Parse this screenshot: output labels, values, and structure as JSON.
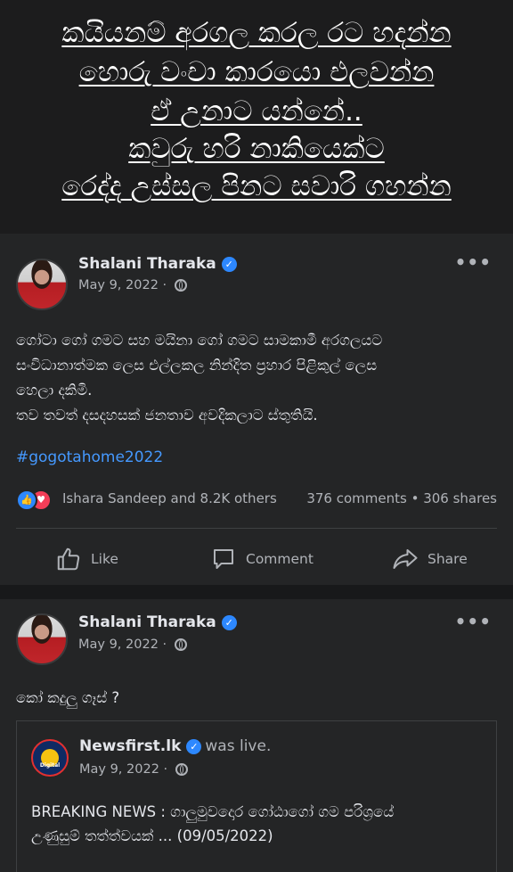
{
  "caption": {
    "lines": [
      "කයියනම් අරගල කරල රට හදන්න",
      "හොරු වංචා කාරයො එලවන්න",
      "ඒ උනාට යන්නේ..",
      "කවුරු හරි නාකියෙක්ට",
      "රෙද්ද උස්සල පිනට සවාරි ගහන්න"
    ]
  },
  "post1": {
    "author": "Shalani Tharaka",
    "date": "May 9, 2022 ·",
    "text_lines": [
      "ගෝටා ගෝ ගමට සහ මයිනා ගෝ ගමට සාමකාමී අරගලයට",
      "සංවිධානාත්මක ලෙස එල්ලකල නින්දිත ප්‍රහාර පිළිකුල් ලෙස",
      "හෙලා දකිමි.",
      "තව තවත් දසදහසක් ජනතාව අවදිකලාට ස්තුතියි."
    ],
    "hashtag": "#gogotahome2022",
    "reactors": "Ishara Sandeep and 8.2K others",
    "counts": "376 comments • 306 shares",
    "actions": {
      "like": "Like",
      "comment": "Comment",
      "share": "Share"
    }
  },
  "post2": {
    "author": "Shalani Tharaka",
    "date": "May 9, 2022 ·",
    "text": "කෝ කදුලු ගෑස් ?",
    "shared": {
      "page": "Newsfirst.lk",
      "status": "was live.",
      "date": "May 9, 2022 ·",
      "logo_text": "Digital",
      "headline_lines": [
        "BREAKING NEWS : ගාලුමුවදොර ගෝඨාගෝ ගම පරිශ්‍රයේ",
        "උණුසුම් තත්ත්වයක් ... (09/05/2022)"
      ]
    }
  },
  "colors": {
    "background": "#242526",
    "separator": "#18191a",
    "text": "#e4e6eb",
    "secondary": "#b0b3b8",
    "link": "#4599ff",
    "verified": "#2d88ff",
    "love": "#f33e58"
  },
  "icons": [
    "verified-badge-icon",
    "globe-icon",
    "more-options-icon",
    "like-reaction-icon",
    "love-reaction-icon",
    "thumbs-up-icon",
    "comment-icon",
    "share-icon"
  ]
}
